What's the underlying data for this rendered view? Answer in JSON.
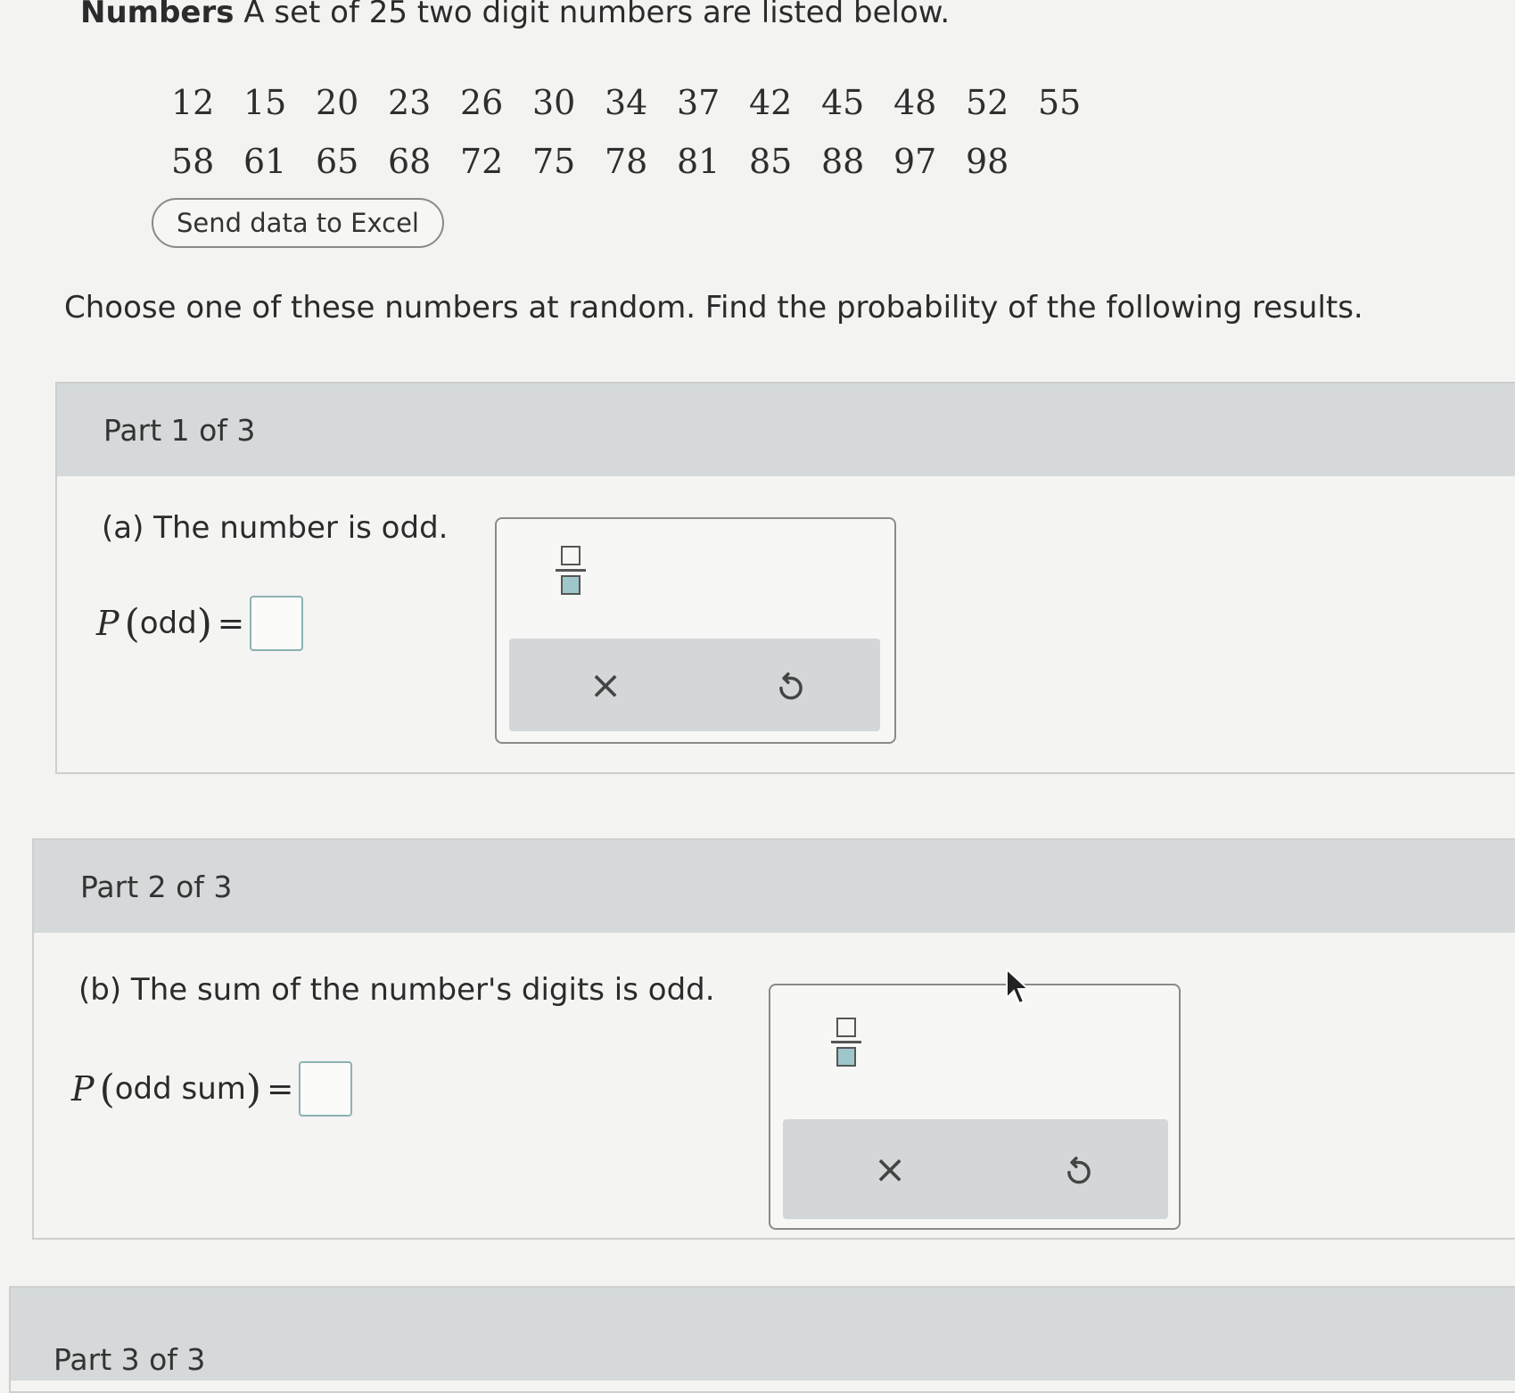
{
  "header": {
    "bold_label": "Numbers",
    "intro_text": " A set of 25 two digit numbers are listed below."
  },
  "numbers": {
    "row1": [
      "12",
      "15",
      "20",
      "23",
      "26",
      "30",
      "34",
      "37",
      "42",
      "45",
      "48",
      "52",
      "55"
    ],
    "row2": [
      "58",
      "61",
      "65",
      "68",
      "72",
      "75",
      "78",
      "81",
      "85",
      "88",
      "97",
      "98"
    ]
  },
  "excel_button": {
    "label": "Send data to Excel"
  },
  "instruction": "Choose one of these numbers at random. Find the probability of the following results.",
  "parts": [
    {
      "header": "Part 1 of 3",
      "question": "(a) The number is odd.",
      "prob_var": "P",
      "prob_arg": "odd",
      "eq": "="
    },
    {
      "header": "Part 2 of 3",
      "question": "(b) The sum of the number's digits is odd.",
      "prob_var": "P",
      "prob_arg": "odd sum",
      "eq": "="
    },
    {
      "header": "Part 3 of 3"
    }
  ],
  "palette": {
    "clear_symbol": "×",
    "icons": [
      "fraction-icon",
      "close-icon",
      "undo-icon"
    ]
  }
}
